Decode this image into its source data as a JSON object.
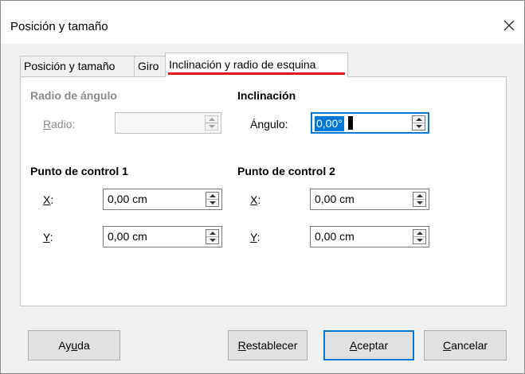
{
  "window": {
    "title": "Posición y tamaño"
  },
  "tabs": [
    {
      "label": "Posición y tamaño",
      "active": false
    },
    {
      "label": "Giro",
      "active": false
    },
    {
      "label": "Inclinación y radio de esquina",
      "active": true
    }
  ],
  "corner_radius": {
    "heading": "Radio de ángulo",
    "radius_label_mnemonic": "R",
    "radius_label_rest": "adio:",
    "radius_value": "",
    "enabled": false
  },
  "slant": {
    "heading": "Inclinación",
    "angle_label_pre": "Án",
    "angle_label_mnemonic": "g",
    "angle_label_post": "ulo:",
    "angle_value": "0,00°"
  },
  "control_point_1": {
    "heading": "Punto de control 1",
    "x_label_mnemonic": "X",
    "x_label_rest": ":",
    "x_value": "0,00 cm",
    "y_label_mnemonic": "Y",
    "y_label_rest": ":",
    "y_value": "0,00 cm"
  },
  "control_point_2": {
    "heading": "Punto de control 2",
    "x_label_mnemonic": "X",
    "x_label_rest": ":",
    "x_value": "0,00 cm",
    "y_label_mnemonic": "Y",
    "y_label_rest": ":",
    "y_value": "0,00 cm"
  },
  "buttons": {
    "help_pre": "Ay",
    "help_mnemonic": "u",
    "help_post": "da",
    "reset_mnemonic": "R",
    "reset_rest": "establecer",
    "ok_mnemonic": "A",
    "ok_rest": "ceptar",
    "cancel_mnemonic": "C",
    "cancel_rest": "ancelar"
  },
  "colors": {
    "accent": "#0078d7",
    "tab_indicator": "#e0141e"
  }
}
